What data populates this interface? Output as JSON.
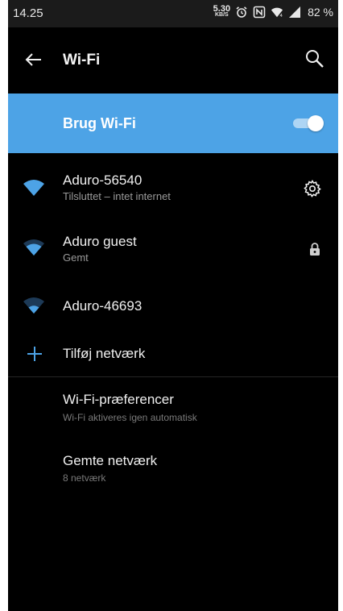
{
  "status_bar": {
    "time": "14.25",
    "net_speed_value": "5.30",
    "net_speed_unit": "KB/S",
    "battery": "82 %",
    "icons": [
      "alarm-icon",
      "nfc-icon",
      "wifi-signal-icon",
      "cell-signal-icon"
    ]
  },
  "toolbar": {
    "title": "Wi-Fi",
    "back_icon": "arrow-back-icon",
    "search_icon": "search-icon"
  },
  "master_switch": {
    "label": "Brug Wi-Fi",
    "enabled": true,
    "color": "#4da3e6"
  },
  "networks": [
    {
      "name": "Aduro-56540",
      "status": "Tilsluttet – intet internet",
      "signal": 1.0,
      "right_icon": "gear-icon"
    },
    {
      "name": "Aduro guest",
      "status": "Gemt",
      "signal": 0.75,
      "right_icon": "lock-icon"
    },
    {
      "name": "Aduro-46693",
      "status": "",
      "signal": 0.5,
      "right_icon": ""
    }
  ],
  "add_network": {
    "label": "Tilføj netværk",
    "icon": "plus-icon"
  },
  "preferences": [
    {
      "title": "Wi-Fi-præferencer",
      "subtitle": "Wi-Fi aktiveres igen automatisk"
    },
    {
      "title": "Gemte netværk",
      "subtitle": "8 netværk"
    }
  ]
}
